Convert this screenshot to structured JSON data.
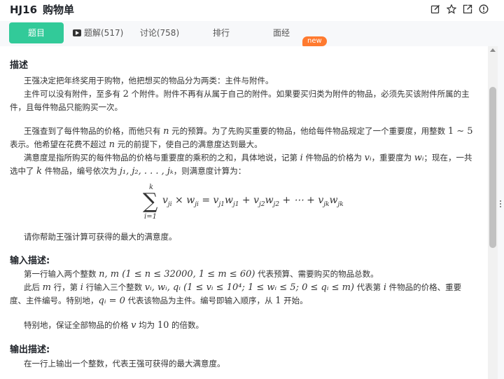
{
  "header": {
    "id": "HJ16",
    "title": "购物单",
    "icons": [
      "edit-icon",
      "star-icon",
      "share-icon",
      "info-icon"
    ]
  },
  "tabs": {
    "problem": "题目",
    "solutions": "题解(517)",
    "discuss": "讨论(758)",
    "rank": "排行",
    "interview": "面经",
    "new_badge": "new"
  },
  "colors": {
    "accent": "#32ca99",
    "badge": "#ff7a2f"
  },
  "content": {
    "desc_title": "描述",
    "p1": "王强决定把年终奖用于购物，他把想买的物品分为两类：主件与附件。",
    "p2a": "主件可以没有附件，至多有 ",
    "p2_num": "2",
    "p2b": " 个附件。附件不再有从属于自己的附件。如果要买归类为附件的物品，必须先买该附件所属的主件，且每件物品只能购买一次。",
    "p3a": "王强查到了每件物品的价格，而他只有 ",
    "p3_n": "n",
    "p3b": " 元的预算。为了先购买重要的物品，他给每件物品规定了一个重要度，用整数 ",
    "p3_range": "1 ∼ 5",
    "p3c": " 表示。他希望在花费不超过 ",
    "p3d": " 元的前提下，使自己的满意度达到最大。",
    "p4a": "满意度是指所购买的每件物品的价格与重要度的乘积的之和，具体地说，记第 ",
    "p4_i": "i",
    "p4b": " 件物品的价格为 ",
    "p4_vi": "vᵢ",
    "p4c": "，重要度为 ",
    "p4_wi": "wᵢ",
    "p4d": "；现在，一共选中了 ",
    "p4_k": "k",
    "p4e": " 件物品，编号依次为 ",
    "p4_seq": "j₁, j₂, . . . , jₖ",
    "p4f": "，则满意度计算为：",
    "formula_top": "k",
    "formula_bottom": "i=1",
    "p5": "请你帮助王强计算可获得的最大的满意度。",
    "input_title": "输入描述:",
    "in1a": "第一行输入两个整数 ",
    "in1_math": "n, m (1 ≤ n ≤ 32000, 1 ≤ m ≤ 60)",
    "in1b": " 代表预算、需要购买的物品总数。",
    "in2a": "此后 ",
    "in2_m": "m",
    "in2b": " 行，第 ",
    "in2_i": "i",
    "in2c": " 行输入三个整数 ",
    "in2_math": "vᵢ, wᵢ, qᵢ (1 ≤ vᵢ ≤ 10⁴; 1 ≤ wᵢ ≤ 5; 0 ≤ qᵢ ≤ m)",
    "in2d": " 代表第 ",
    "in2e": " 件物品的价格、重要度、主件编号。特别地，",
    "in2_q": "qᵢ = 0",
    "in2f": " 代表该物品为主件。编号即输入顺序，从 ",
    "in2_one": "1",
    "in2g": " 开始。",
    "in3a": "特别地，保证全部物品的价格 ",
    "in3_v": "v",
    "in3b": " 均为 ",
    "in3_ten": "10",
    "in3c": " 的倍数。",
    "output_title": "输出描述:",
    "out1": "在一行上输出一个整数，代表王强可获得的最大满意度。"
  }
}
